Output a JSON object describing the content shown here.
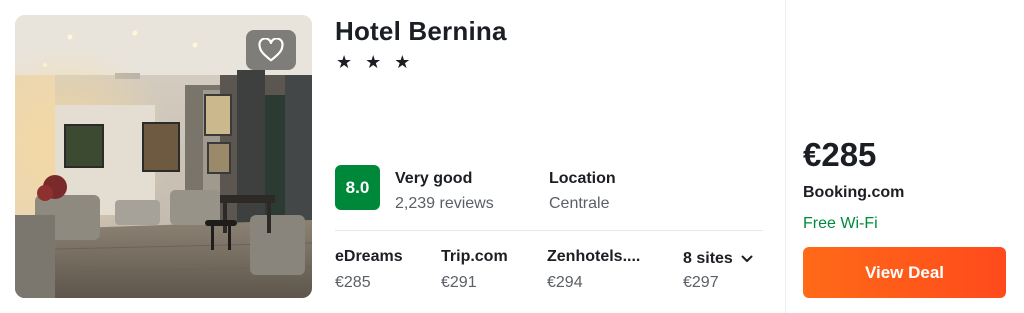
{
  "hotel": {
    "name": "Hotel Bernina",
    "stars": "★ ★ ★",
    "star_count": 3
  },
  "rating": {
    "score": "8.0",
    "label": "Very good",
    "reviews": "2,239 reviews",
    "badge_color": "#00883a"
  },
  "location": {
    "label": "Location",
    "value": "Centrale"
  },
  "deals": [
    {
      "site": "eDreams",
      "price": "€285"
    },
    {
      "site": "Trip.com",
      "price": "€291"
    },
    {
      "site": "Zenhotels....",
      "price": "€294"
    }
  ],
  "more_sites": {
    "label": "8 sites",
    "price": "€297"
  },
  "best_offer": {
    "price": "€285",
    "site": "Booking.com",
    "amenity": "Free Wi-Fi",
    "button_label": "View Deal",
    "button_color": "#ff5a1a",
    "amenity_color": "#008a3c"
  },
  "icons": {
    "favorite": "heart-outline-icon",
    "expand": "chevron-down-icon"
  }
}
